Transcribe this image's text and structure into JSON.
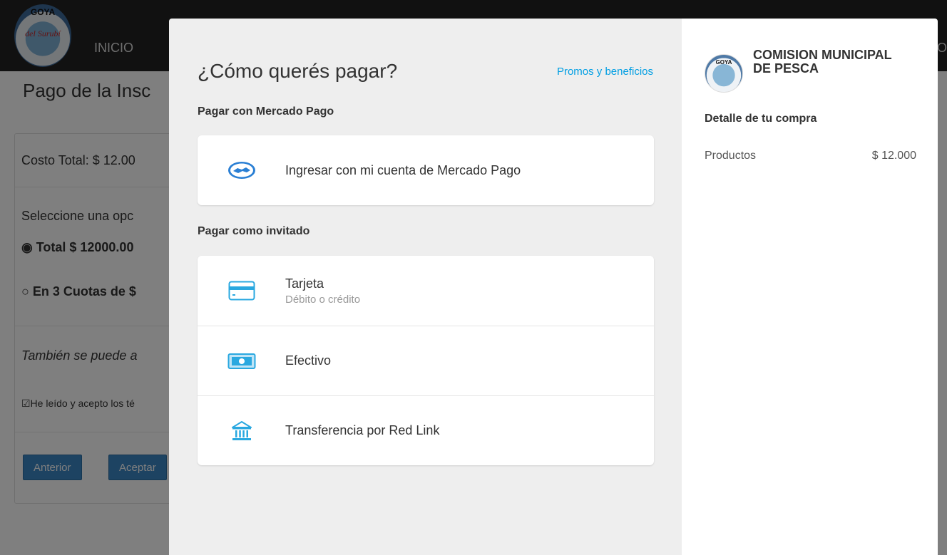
{
  "background": {
    "nav": {
      "logo_text": "GOYA",
      "logo_subtitle": "del Surubí",
      "inicio": "INICIO",
      "right_fragment": "O"
    },
    "page_title": "Pago de la Insc",
    "cost_total": "Costo Total: $ 12.00",
    "select_prompt": "Seleccione una opc",
    "option_total": "◉ Total $ 12000.00",
    "option_cuotas": "○ En 3 Cuotas de $",
    "also_text": "También se puede a",
    "terms": "☑He leído y acepto los té",
    "btn_anterior": "Anterior",
    "btn_aceptar": "Aceptar"
  },
  "checkout": {
    "title": "¿Cómo querés pagar?",
    "promos_link": "Promos y beneficios",
    "section_mp": "Pagar con Mercado Pago",
    "mp_option": "Ingresar con mi cuenta de Mercado Pago",
    "section_guest": "Pagar como invitado",
    "guest_options": [
      {
        "label": "Tarjeta",
        "sublabel": "Débito o crédito",
        "icon": "credit-card-icon"
      },
      {
        "label": "Efectivo",
        "icon": "cash-icon"
      },
      {
        "label": "Transferencia por Red Link",
        "icon": "bank-icon"
      }
    ]
  },
  "summary": {
    "logo_text": "GOYA",
    "store_name": "COMISION MUNICIPAL DE PESCA",
    "detail_title": "Detalle de tu compra",
    "products_label": "Productos",
    "products_amount": "$ 12.000"
  },
  "colors": {
    "accent": "#009ee3",
    "icon_blue": "#2aa8e0",
    "overlay": "rgba(0,0,0,0.5)"
  }
}
